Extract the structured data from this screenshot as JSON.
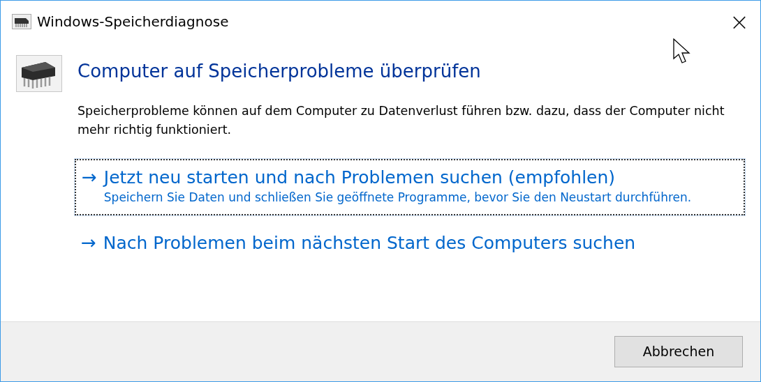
{
  "window": {
    "title": "Windows-Speicherdiagnose",
    "close": "×"
  },
  "heading": "Computer auf Speicherprobleme überprüfen",
  "description": "Speicherprobleme können auf dem Computer zu Datenverlust führen bzw. dazu, dass der Computer nicht mehr richtig funktioniert.",
  "options": [
    {
      "arrow": "→",
      "label": "Jetzt neu starten und nach Problemen suchen (empfohlen)",
      "note": "Speichern Sie Daten und schließen Sie geöffnete Programme, bevor Sie den Neustart durchführen.",
      "selected": true
    },
    {
      "arrow": "→",
      "label": "Nach Problemen beim nächsten Start des Computers suchen",
      "selected": false
    }
  ],
  "buttons": [
    "Abbrechen"
  ]
}
